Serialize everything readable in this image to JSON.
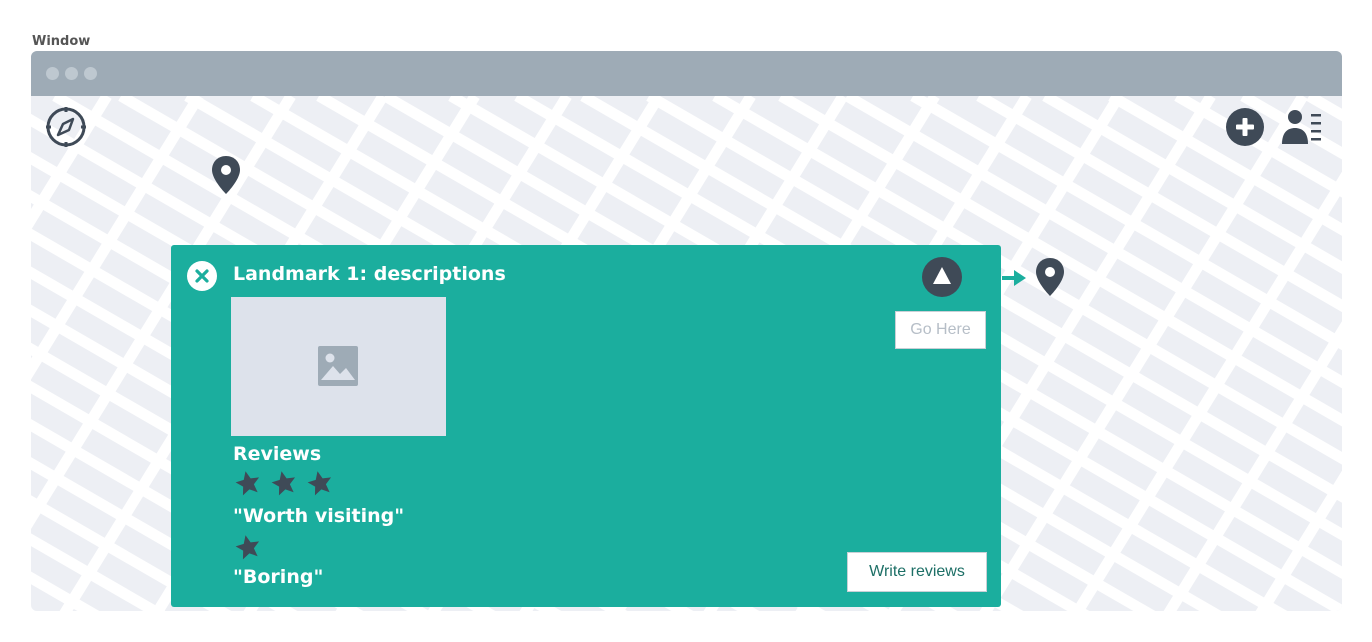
{
  "window": {
    "label": "Window"
  },
  "toolbar": {
    "compass_icon": "compass-icon",
    "add_icon": "plus-circle-icon",
    "profile_icon": "user-list-icon"
  },
  "map": {
    "pins": [
      "map-pin-icon",
      "map-pin-icon"
    ],
    "route_arrow": "arrow-right-icon"
  },
  "landmark_panel": {
    "title": "Landmark 1: descriptions",
    "close_icon": "close-icon",
    "navigate_icon": "navigation-arrow-icon",
    "go_here_label": "Go Here",
    "image_icon": "image-placeholder-icon",
    "reviews_heading": "Reviews",
    "reviews": [
      {
        "rating": 3,
        "text": "\"Worth visiting\""
      },
      {
        "rating": 1,
        "text": "\"Boring\""
      }
    ],
    "write_reviews_label": "Write reviews"
  },
  "colors": {
    "panel": "#1bae9e",
    "titlebar": "#9eabb6",
    "map_bg": "#edeff4",
    "icon_dark": "#3f4a57"
  }
}
